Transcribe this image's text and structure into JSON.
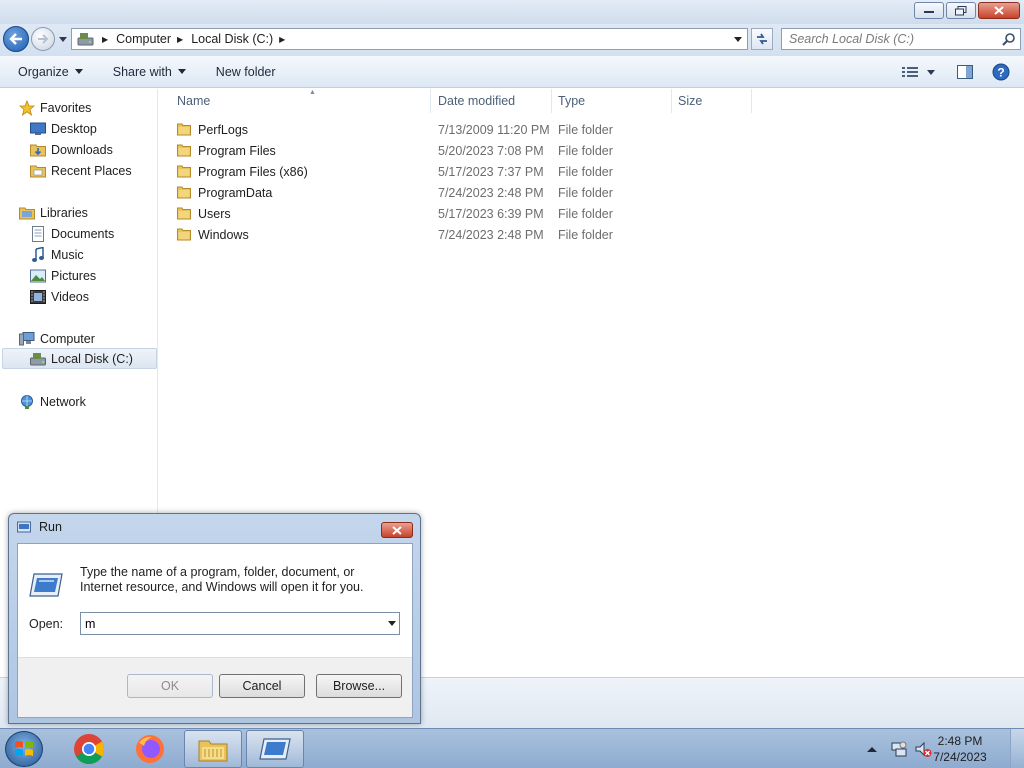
{
  "window": {
    "minimize_icon": "minimize-icon",
    "maximize_icon": "restore-icon",
    "close_icon": "close-icon"
  },
  "navigation": {
    "breadcrumb": [
      "Computer",
      "Local Disk (C:)"
    ],
    "search_placeholder": "Search Local Disk (C:)"
  },
  "command_bar": {
    "organize": "Organize",
    "share_with": "Share with",
    "new_folder": "New folder"
  },
  "sidebar": {
    "favorites": {
      "label": "Favorites",
      "items": [
        "Desktop",
        "Downloads",
        "Recent Places"
      ]
    },
    "libraries": {
      "label": "Libraries",
      "items": [
        "Documents",
        "Music",
        "Pictures",
        "Videos"
      ]
    },
    "computer": {
      "label": "Computer",
      "items": [
        "Local Disk (C:)"
      ]
    },
    "network": {
      "label": "Network"
    }
  },
  "file_list": {
    "columns": [
      "Name",
      "Date modified",
      "Type",
      "Size"
    ],
    "rows": [
      {
        "name": "PerfLogs",
        "date": "7/13/2009 11:20 PM",
        "type": "File folder"
      },
      {
        "name": "Program Files",
        "date": "5/20/2023 7:08 PM",
        "type": "File folder"
      },
      {
        "name": "Program Files (x86)",
        "date": "5/17/2023 7:37 PM",
        "type": "File folder"
      },
      {
        "name": "ProgramData",
        "date": "7/24/2023 2:48 PM",
        "type": "File folder"
      },
      {
        "name": "Users",
        "date": "5/17/2023 6:39 PM",
        "type": "File folder"
      },
      {
        "name": "Windows",
        "date": "7/24/2023 2:48 PM",
        "type": "File folder"
      }
    ]
  },
  "run_dialog": {
    "title": "Run",
    "message": "Type the name of a program, folder, document, or Internet resource, and Windows will open it for you.",
    "open_label": "Open:",
    "open_value": "m",
    "ok": "OK",
    "cancel": "Cancel",
    "browse": "Browse..."
  },
  "taskbar": {
    "time": "2:48 PM",
    "date": "7/24/2023"
  },
  "colors": {
    "folder_yellow": "#e8c25a",
    "accent_blue": "#1d5eae",
    "close_red": "#c7432b"
  }
}
